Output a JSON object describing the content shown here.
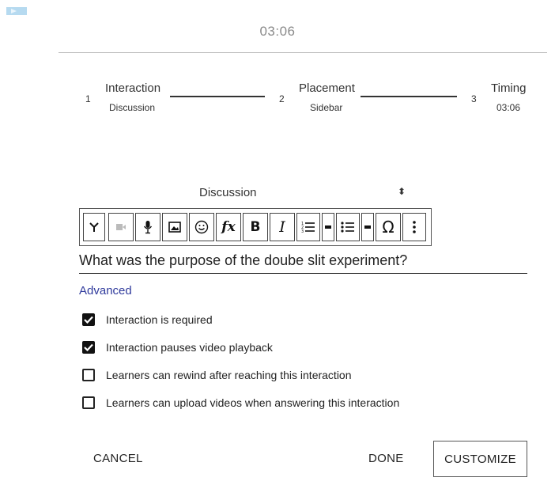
{
  "header": {
    "timer": "03:06"
  },
  "stepper": {
    "steps": [
      {
        "num": "1",
        "title": "Interaction",
        "sub": "Discussion"
      },
      {
        "num": "2",
        "title": "Placement",
        "sub": "Sidebar"
      },
      {
        "num": "3",
        "title": "Timing",
        "sub": "03:06"
      }
    ]
  },
  "interaction_type": {
    "selected": "Discussion",
    "arrow": "⬍"
  },
  "toolbar": {
    "icons": [
      "branch-icon",
      "video-icon",
      "microphone-icon",
      "image-icon",
      "emoji-icon",
      "formula-icon",
      "bold-icon",
      "italic-icon",
      "numbered-list-icon",
      "dash-icon",
      "bulleted-list-icon",
      "dash-icon",
      "omega-icon",
      "more-icon"
    ],
    "formula": "fx",
    "bold": "B",
    "italic": "I",
    "omega": "Ω"
  },
  "question": {
    "text": "What was the purpose of the doube slit experiment?"
  },
  "advanced": {
    "label": "Advanced",
    "options": [
      {
        "label": "Interaction is required",
        "checked": true
      },
      {
        "label": "Interaction pauses video playback",
        "checked": true
      },
      {
        "label": "Learners can rewind after reaching this interaction",
        "checked": false
      },
      {
        "label": "Learners can upload videos when answering this interaction",
        "checked": false
      }
    ]
  },
  "footer": {
    "cancel": "CANCEL",
    "done": "DONE",
    "customize": "CUSTOMIZE"
  }
}
